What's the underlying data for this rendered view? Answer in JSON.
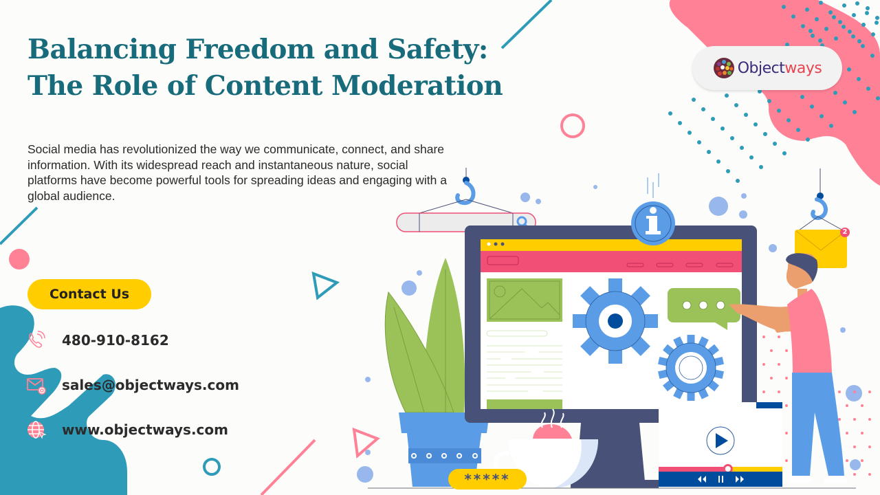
{
  "header": {
    "title_line1": "Balancing Freedom and Safety:",
    "title_line2": "The Role of Content Moderation"
  },
  "intro": {
    "text": "Social media has revolutionized the way we communicate, connect, and share information. With its widespread reach and instantaneous nature, social platforms have become powerful tools for spreading ideas and engaging with a global audience."
  },
  "cta": {
    "label": "Contact Us"
  },
  "contacts": [
    {
      "icon": "phone-icon",
      "value": "480-910-8162"
    },
    {
      "icon": "mail-icon",
      "value": "sales@objectways.com"
    },
    {
      "icon": "globe-icon",
      "value": "www.objectways.com"
    }
  ],
  "brand": {
    "name_part1": "Object",
    "name_part2": "ways",
    "colors": {
      "primary": "#3b2a78",
      "accent": "#e8434f"
    }
  },
  "illustration": {
    "rating_text": "*****",
    "notification_badge": "2",
    "info_glyph": "i",
    "video_progress_percent": 56
  },
  "colors": {
    "teal": "#2e9cb8",
    "title": "#176b7b",
    "pink": "#ff8196",
    "yellow": "#ffcd00",
    "monitor": "#485177",
    "blue": "#5a9de6",
    "green": "#9bc159"
  }
}
